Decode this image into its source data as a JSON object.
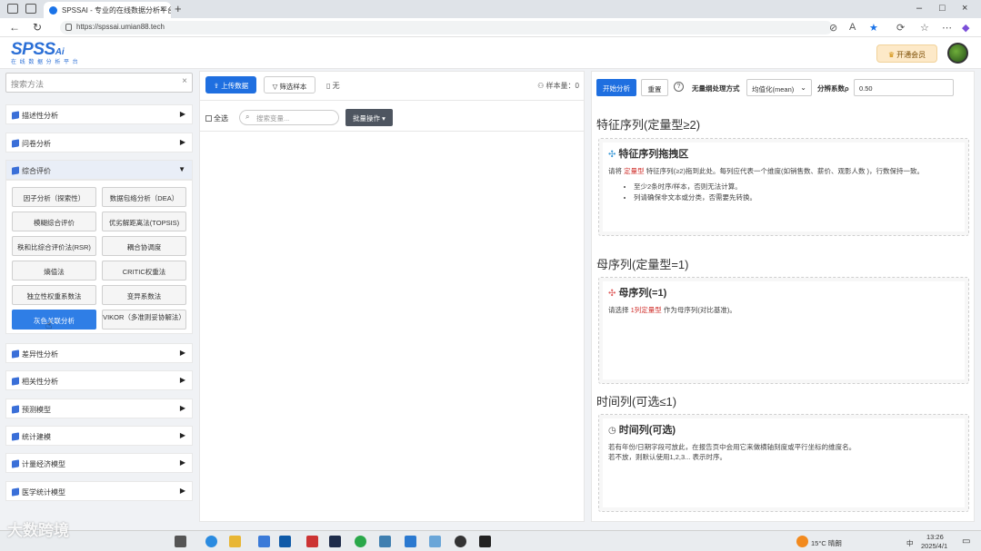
{
  "browser": {
    "tab_title": "SPSSAI - 专业的在线数据分析平台",
    "url": "https://spssai.umian88.tech"
  },
  "header": {
    "logo_main": "SPSS",
    "logo_ai": "Ai",
    "logo_sub": "在 线 数 据 分 析 平 台",
    "vip_label": "开通会员"
  },
  "sidebar": {
    "search_placeholder": "搜索方法",
    "categories_top": [
      {
        "label": "描述性分析"
      },
      {
        "label": "问卷分析"
      },
      {
        "label": "综合评价"
      }
    ],
    "methods": [
      "因子分析（探索性）",
      "数据包络分析（DEA）",
      "模糊综合评价",
      "优劣解距离法(TOPSIS)",
      "秩和比综合评价法(RSR)",
      "耦合协调度",
      "熵值法",
      "CRITIC权重法",
      "独立性权重系数法",
      "变异系数法",
      "灰色关联分析",
      "VIKOR（多准则妥协解法）"
    ],
    "categories_bottom": [
      {
        "label": "差异性分析"
      },
      {
        "label": "相关性分析"
      },
      {
        "label": "预测模型"
      },
      {
        "label": "统计建模"
      },
      {
        "label": "计量经济模型"
      },
      {
        "label": "医学统计模型"
      }
    ]
  },
  "center": {
    "upload_label": "上传数据",
    "filter_label": "筛选样本",
    "none_label": "无",
    "sample_count_label": "样本量：",
    "sample_count": "0",
    "select_all_label": "全选",
    "var_search_placeholder": "搜索变量...",
    "batch_label": "批量操作"
  },
  "right": {
    "start_label": "开始分析",
    "reset_label": "重置",
    "dim_label": "无量纲处理方式",
    "dim_value": "均值化(mean)",
    "rho_label": "分辨系数ρ",
    "rho_value": "0.50",
    "feature_section_title": "特征序列(定量型≥2)",
    "feature_zone_title": "特征序列拖拽区",
    "feature_desc_pre": "请将",
    "feature_desc_red": "定量型",
    "feature_desc_post": "特征序列(≥2)拖到此处。每列应代表一个维度(如销售数、薪价、观影人数 )，行数保持一致。",
    "feature_bullets": [
      "至少2条时序/样本，否则无法计算。",
      "列请确保非文本或分类，否需要先转换。"
    ],
    "mother_section_title": "母序列(定量型=1)",
    "mother_zone_title": "母序列(=1)",
    "mother_desc_pre": "请选择",
    "mother_desc_red": "1列定量型",
    "mother_desc_post": "作为母序列(对比基准)。",
    "time_section_title": "时间列(可选≤1)",
    "time_zone_title": "时间列(可选)",
    "time_desc_1": "若有年份/日期字段可放此，在报告页中会用它来做横轴刻度或平行坐标的维度名。",
    "time_desc_2": "若不放，则默认使用1,2,3... 表示时序。"
  },
  "taskbar": {
    "watermark": "大数跨境",
    "weather": "15°C 晴朗",
    "ime": "中",
    "time": "13:26",
    "date": "2025/4/1"
  }
}
